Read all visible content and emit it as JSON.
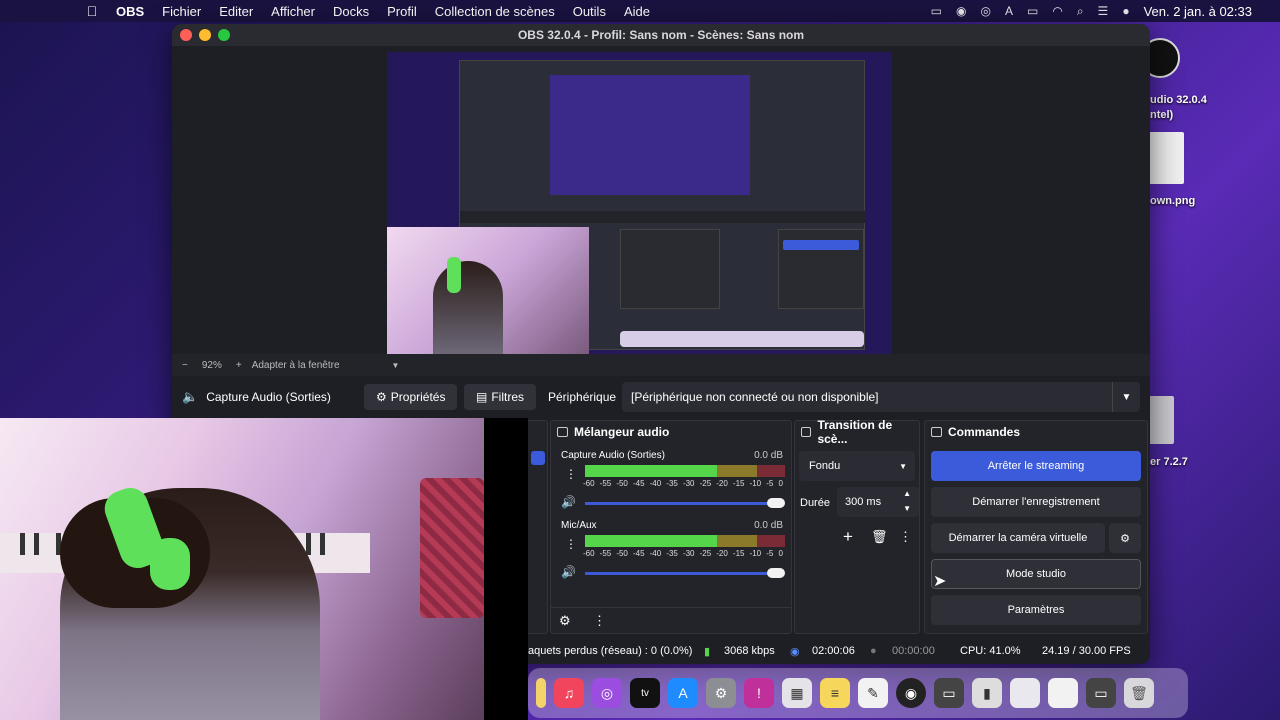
{
  "menubar": {
    "app": "OBS",
    "items": [
      "Fichier",
      "Editer",
      "Afficher",
      "Docks",
      "Profil",
      "Collection de scènes",
      "Outils",
      "Aide"
    ],
    "clock": "Ven. 2 jan. à 02:33"
  },
  "desktop": {
    "items": [
      "udio 32.0.4",
      "ntel)",
      "own.png",
      "er 7.2.7"
    ]
  },
  "window": {
    "title": "OBS 32.0.4 - Profil: Sans nom - Scènes: Sans nom"
  },
  "zoombar": {
    "zoom": "92%",
    "fit": "Adapter à la fenêtre"
  },
  "sourcebar": {
    "source": "Capture Audio (Sorties)",
    "properties": "Propriétés",
    "filters": "Filtres",
    "device_label": "Périphérique",
    "device_value": "[Périphérique non connecté ou non disponible]"
  },
  "mixer": {
    "title": "Mélangeur audio",
    "channels": [
      {
        "name": "Capture Audio (Sorties)",
        "db": "0.0 dB",
        "level": 0.62
      },
      {
        "name": "Mic/Aux",
        "db": "0.0 dB",
        "level": 0.55
      }
    ],
    "ticks": [
      "-60",
      "-55",
      "-50",
      "-45",
      "-40",
      "-35",
      "-30",
      "-25",
      "-20",
      "-15",
      "-10",
      "-5",
      "0"
    ]
  },
  "transition": {
    "title": "Transition de scè...",
    "type": "Fondu",
    "duration_label": "Durée",
    "duration": "300 ms"
  },
  "commands": {
    "title": "Commandes",
    "buttons": [
      "Arrêter le streaming",
      "Démarrer l'enregistrement",
      "Démarrer la caméra virtuelle",
      "Mode studio",
      "Paramètres"
    ]
  },
  "status": {
    "dropped": "aquets perdus (réseau) : 0 (0.0%)",
    "bitrate": "3068 kbps",
    "stream_time": "02:00:06",
    "rec_time": "00:00:00",
    "cpu": "CPU: 41.0%",
    "fps": "24.19 / 30.00 FPS"
  },
  "colors": {
    "accent": "#3b5bdb",
    "meter_green": "#55d64a",
    "headset": "#5fe05a"
  }
}
